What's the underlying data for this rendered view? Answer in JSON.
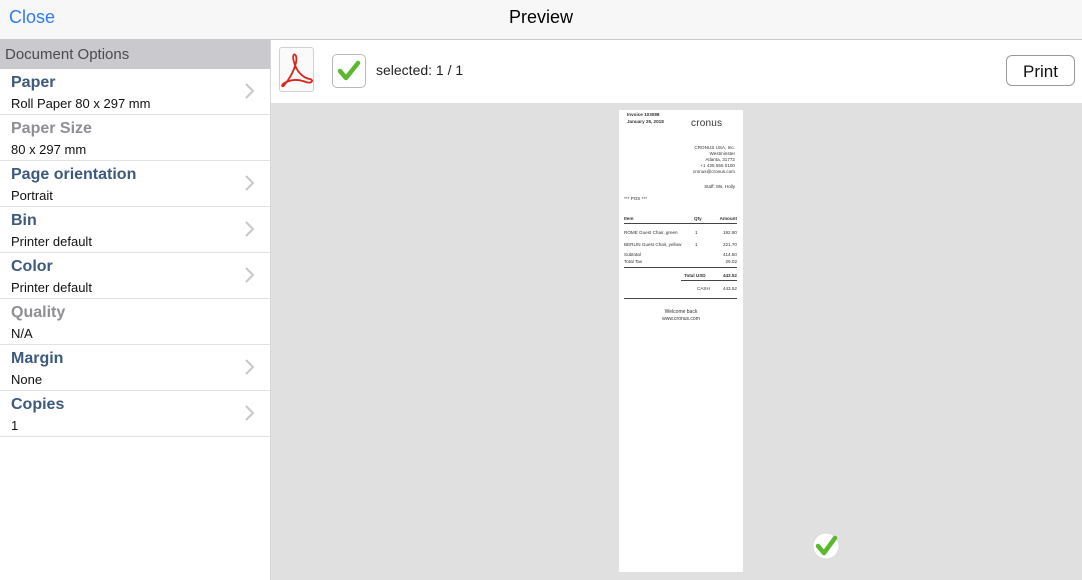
{
  "navbar": {
    "close_label": "Close",
    "title": "Preview"
  },
  "sidebar": {
    "header": "Document Options",
    "items": [
      {
        "label": "Paper",
        "value": "Roll Paper 80 x 297 mm",
        "enabled": true
      },
      {
        "label": "Paper Size",
        "value": "80 x 297 mm",
        "enabled": false
      },
      {
        "label": "Page orientation",
        "value": "Portrait",
        "enabled": true
      },
      {
        "label": "Bin",
        "value": "Printer default",
        "enabled": true
      },
      {
        "label": "Color",
        "value": "Printer default",
        "enabled": true
      },
      {
        "label": "Quality",
        "value": "N/A",
        "enabled": false
      },
      {
        "label": "Margin",
        "value": "None",
        "enabled": true
      },
      {
        "label": "Copies",
        "value": "1",
        "enabled": true
      }
    ]
  },
  "toolbar": {
    "selected_text": "selected: 1 / 1",
    "print_label": "Print",
    "file_icon": "pdf-icon",
    "check_icon": "checkmark-icon"
  },
  "receipt": {
    "invoice": "Invoice 103088",
    "date": "January 25, 2018",
    "logo": "cronus",
    "company": "CRONUS USA, Inc.",
    "street": "Westminster",
    "city": "Atlanta, 31772",
    "phone": "+1 425 555 0100",
    "email": "cronus@cronus.com",
    "staff": "Staff: Ms. Holly",
    "pos": "*** POS ***",
    "headers": {
      "item": "Item",
      "qty": "Qty",
      "amount": "Amount"
    },
    "lines": [
      {
        "item": "ROME Guest Chair, green",
        "qty": "1",
        "amount": "192.80"
      },
      {
        "item": "BERLIN Guest Chair, yellow",
        "qty": "1",
        "amount": "221.70"
      }
    ],
    "subtotal_label": "Subtotal",
    "subtotal": "414.50",
    "tax_label": "Total Tax",
    "tax": "29.02",
    "total_label": "Total USD",
    "total": "443.52",
    "cash_label": "CASH",
    "cash": "443.52",
    "footer1": "Welcome back",
    "footer2": "www.cronus.com"
  },
  "colors": {
    "accent": "#2f7bf5",
    "label": "#3d5a7c",
    "disabled": "#8e8e93",
    "check": "#5cb82e"
  }
}
